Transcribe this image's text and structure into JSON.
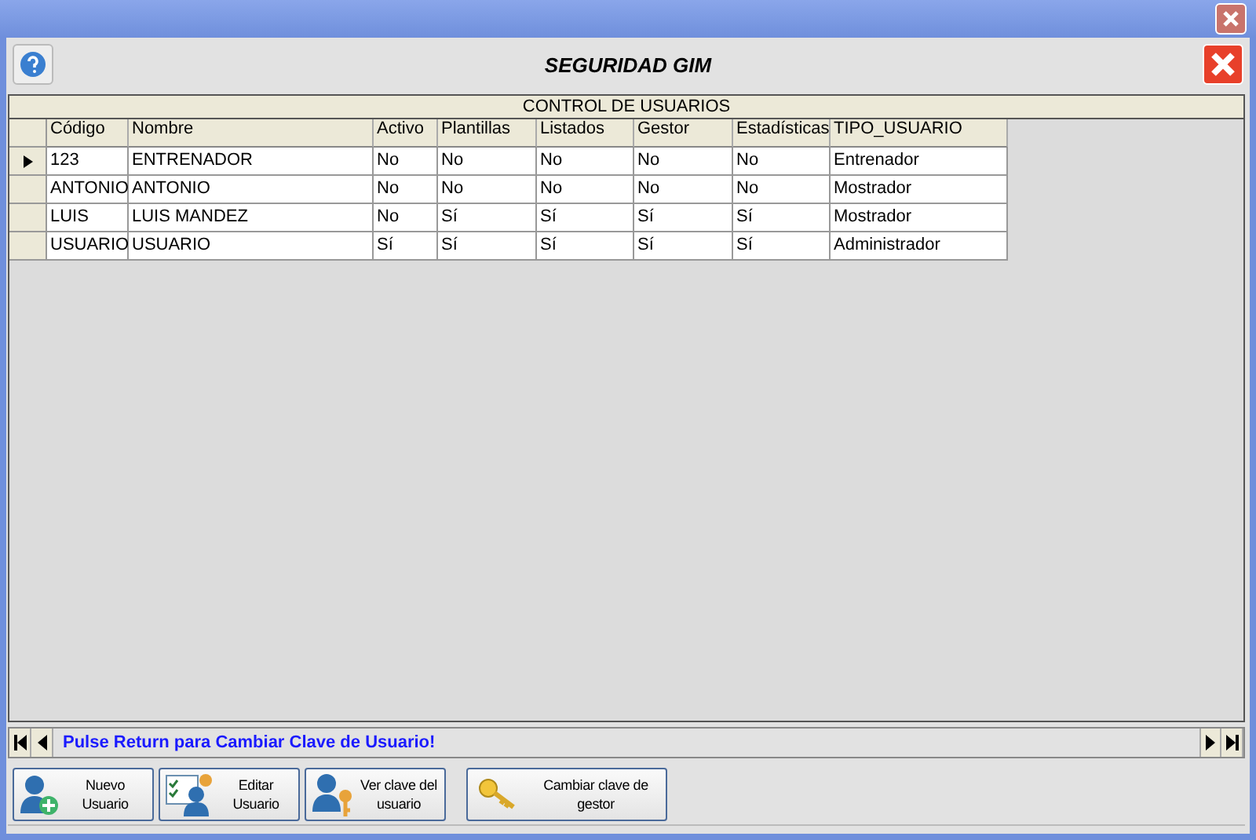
{
  "window": {
    "title": "SEGURIDAD GIM"
  },
  "grid": {
    "caption": "CONTROL DE USUARIOS",
    "columns": [
      "Código",
      "Nombre",
      "Activo",
      "Plantillas",
      "Listados",
      "Gestor",
      "Estadísticas",
      "TIPO_USUARIO"
    ],
    "rows": [
      {
        "selected": true,
        "cells": [
          "123",
          "ENTRENADOR",
          "No",
          "No",
          "No",
          "No",
          "No",
          "Entrenador"
        ]
      },
      {
        "selected": false,
        "cells": [
          "ANTONIO",
          "ANTONIO",
          "No",
          "No",
          "No",
          "No",
          "No",
          "Mostrador"
        ]
      },
      {
        "selected": false,
        "cells": [
          "LUIS",
          "LUIS MANDEZ",
          "No",
          "Sí",
          "Sí",
          "Sí",
          "Sí",
          "Mostrador"
        ]
      },
      {
        "selected": false,
        "cells": [
          "USUARIO",
          "USUARIO",
          "Sí",
          "Sí",
          "Sí",
          "Sí",
          "Sí",
          "Administrador"
        ]
      }
    ]
  },
  "navigator": {
    "message": "Pulse Return para Cambiar Clave de Usuario!"
  },
  "buttons": [
    {
      "kind": "new-user",
      "label": "Nuevo Usuario"
    },
    {
      "kind": "edit-user",
      "label": "Editar Usuario"
    },
    {
      "kind": "view-key",
      "label": "Ver clave del usuario"
    },
    {
      "kind": "key",
      "label": "Cambiar clave de gestor"
    }
  ]
}
